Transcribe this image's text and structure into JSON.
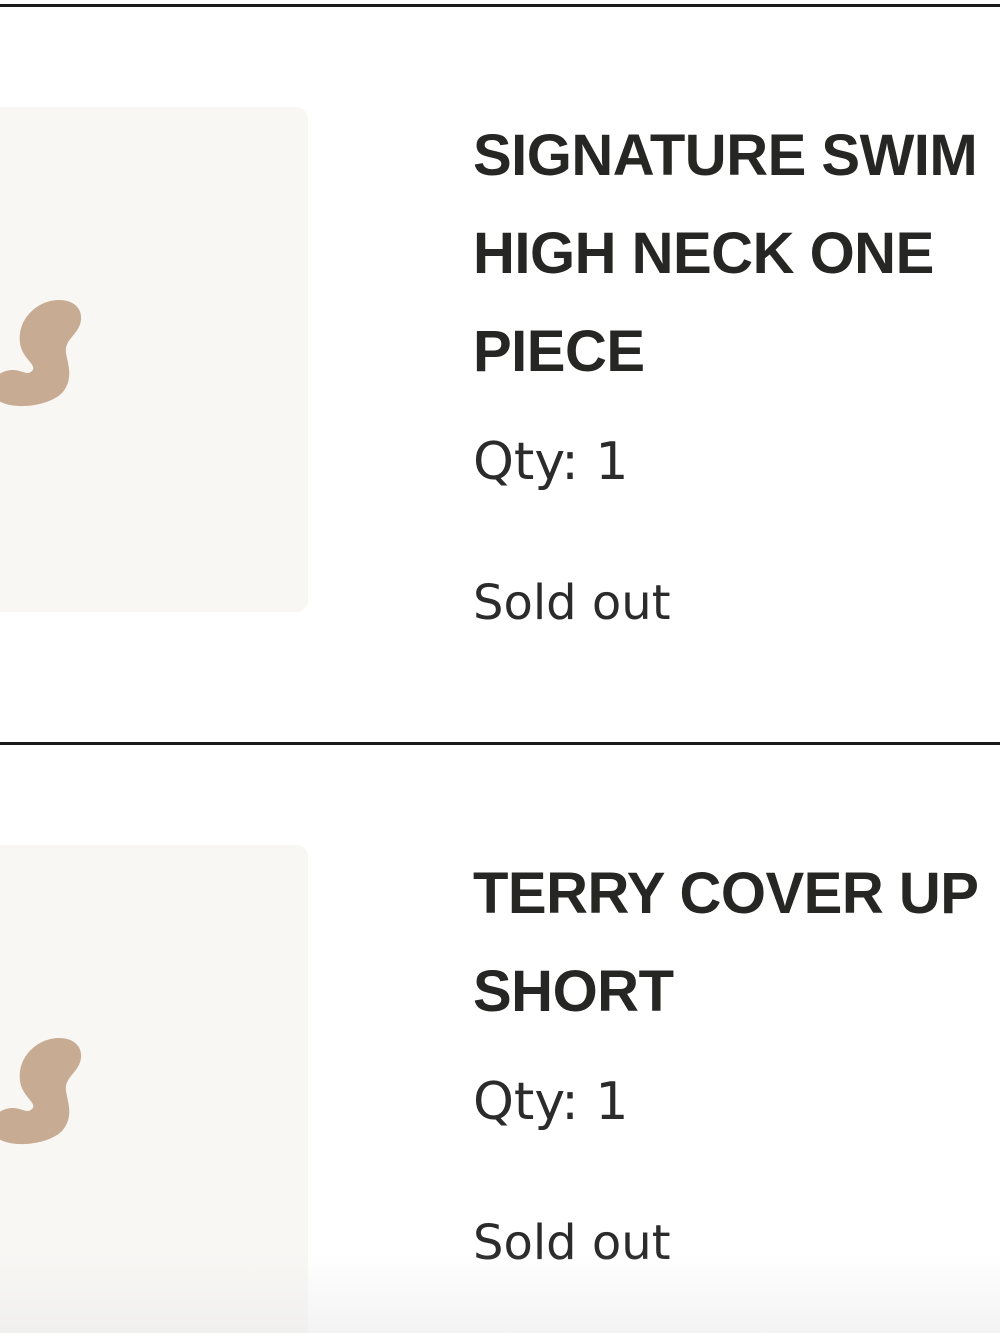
{
  "colors": {
    "divider": "#1a1a1a",
    "thumbnail_bg": "#f8f7f4",
    "logo": "#c8ab93",
    "text": "#2b2b2b"
  },
  "cart": {
    "items": [
      {
        "title_lines": [
          "SIGNATURE SWIM",
          "HIGH NECK ONE",
          "PIECE"
        ],
        "qty_label": "Qty: 1",
        "status": "Sold out",
        "thumbnail_icon": "brand-s-logo-icon"
      },
      {
        "title_lines": [
          "TERRY COVER UP",
          "SHORT"
        ],
        "qty_label": "Qty: 1",
        "status": "Sold out",
        "thumbnail_icon": "brand-s-logo-icon"
      }
    ]
  }
}
